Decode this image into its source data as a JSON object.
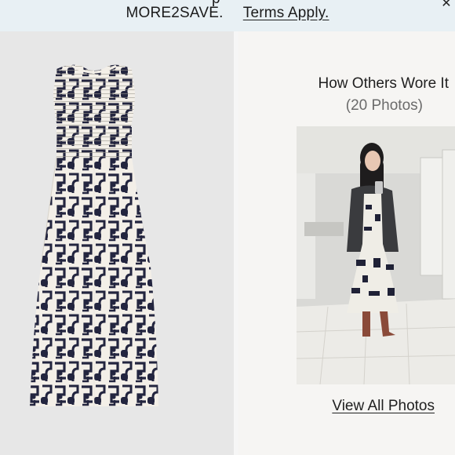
{
  "promo": {
    "cut_text": "p",
    "code": "MORE2SAVE.",
    "terms_link": "Terms Apply."
  },
  "close_icon": "close-icon",
  "product": {
    "image": "product-image-dress",
    "background": "#e7e7e7",
    "print_colors": [
      "#f3efe8",
      "#23253f"
    ]
  },
  "ugc": {
    "title": "How Others Wore It",
    "count": "(20 Photos)",
    "photo": "customer-photo",
    "view_all": "View All Photos"
  }
}
